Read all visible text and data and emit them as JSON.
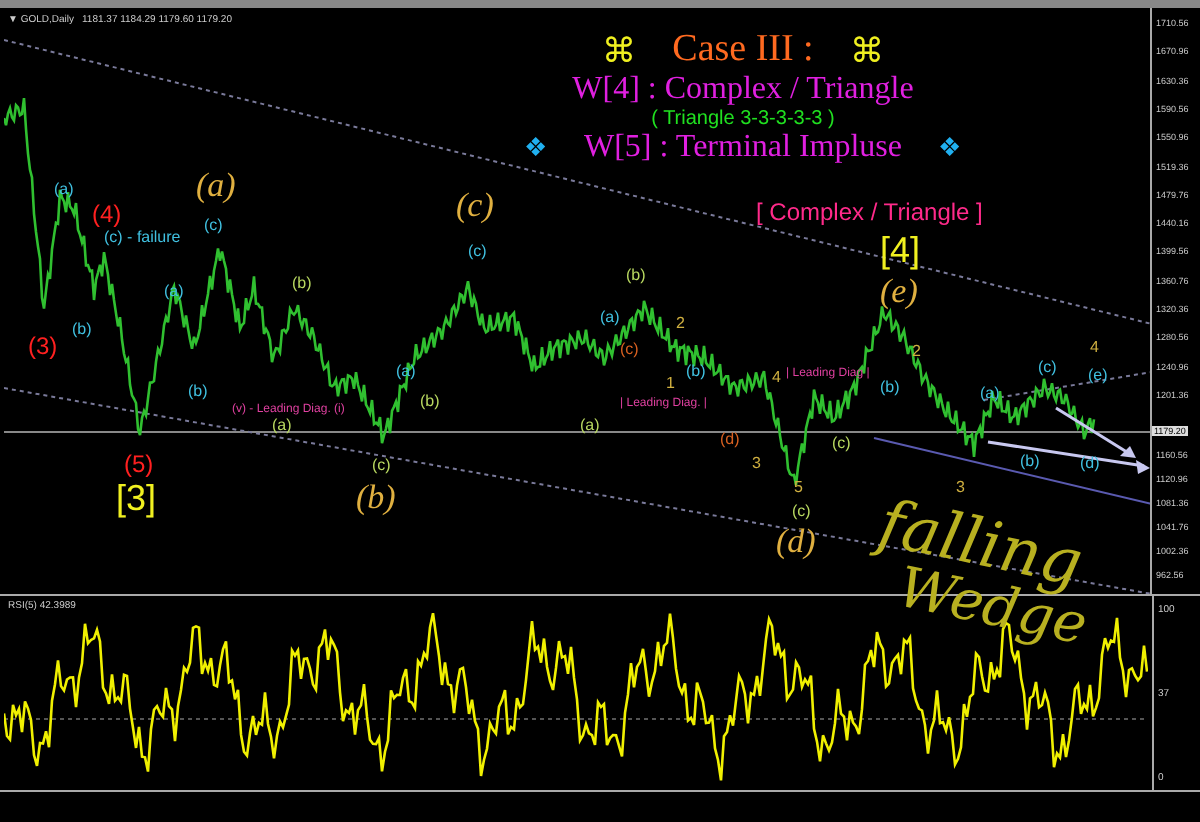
{
  "chart_header": {
    "symbol": "▼ GOLD,Daily",
    "quote": "1181.37 1184.29 1179.60 1179.20"
  },
  "title_block": {
    "mark": "⌘",
    "case_title": "Case III :",
    "line_1": "W[4] : Complex / Triangle",
    "line_2": "( Triangle 3-3-3-3-3 )",
    "bullet": "❖",
    "line_3": "W[5] : Terminal Impluse"
  },
  "wave_labels": [
    {
      "text": "(3)",
      "color": "#ff2020",
      "kind": "mid"
    },
    {
      "text": "(4)",
      "color": "#ff2020",
      "kind": "mid"
    },
    {
      "text": "(5)",
      "color": "#ff2020",
      "kind": "mid"
    },
    {
      "text": "[3]",
      "color": "#f0f020",
      "kind": "big"
    },
    {
      "text": "[ Complex / Triangle ]",
      "color": "#ff2a8a",
      "kind": "mid"
    },
    {
      "text": "[4]",
      "color": "#f0f020",
      "kind": "big"
    },
    {
      "text": "(a)",
      "color": "#e0b040",
      "kind": "italic"
    },
    {
      "text": "(b)",
      "color": "#e0b040",
      "kind": "italic"
    },
    {
      "text": "(c)",
      "color": "#e0b040",
      "kind": "italic"
    },
    {
      "text": "(d)",
      "color": "#e0b040",
      "kind": "italic"
    },
    {
      "text": "(e)",
      "color": "#e0b040",
      "kind": "italic"
    },
    {
      "text": "(a)",
      "color": "#40c0e0",
      "kind": "small"
    },
    {
      "text": "(c) - failure",
      "color": "#40c0e0",
      "kind": "small"
    },
    {
      "text": "(b)",
      "color": "#40c0e0",
      "kind": "small"
    },
    {
      "text": "(c)",
      "color": "#40c0e0",
      "kind": "small"
    },
    {
      "text": "(a)",
      "color": "#40c0e0",
      "kind": "small"
    },
    {
      "text": "(b)",
      "color": "#40c0e0",
      "kind": "small"
    },
    {
      "text": "(c)",
      "color": "#40c0e0",
      "kind": "small"
    },
    {
      "text": "(a)",
      "color": "#40c0e0",
      "kind": "small"
    },
    {
      "text": "(b)",
      "color": "#40c0e0",
      "kind": "small"
    },
    {
      "text": "(a)",
      "color": "#40c0e0",
      "kind": "small"
    },
    {
      "text": "(b)",
      "color": "#40c0e0",
      "kind": "small"
    },
    {
      "text": "(a)",
      "color": "#40c0e0",
      "kind": "small"
    },
    {
      "text": "(c)",
      "color": "#40c0e0",
      "kind": "small"
    },
    {
      "text": "(e)",
      "color": "#40c0e0",
      "kind": "small"
    },
    {
      "text": "(b)",
      "color": "#40c0e0",
      "kind": "small"
    },
    {
      "text": "(d)",
      "color": "#40c0e0",
      "kind": "small"
    },
    {
      "text": "(b)",
      "color": "#b8d860",
      "kind": "small"
    },
    {
      "text": "(a)",
      "color": "#b8d860",
      "kind": "small"
    },
    {
      "text": "(c)",
      "color": "#b8d860",
      "kind": "small"
    },
    {
      "text": "(b)",
      "color": "#b8d860",
      "kind": "small"
    },
    {
      "text": "(a)",
      "color": "#b8d860",
      "kind": "small"
    },
    {
      "text": "(c)",
      "color": "#b8d860",
      "kind": "small"
    },
    {
      "text": "(b)",
      "color": "#b8d860",
      "kind": "small"
    },
    {
      "text": "(c)",
      "color": "#b8d860",
      "kind": "small"
    },
    {
      "text": "(v) - Leading Diag. (i)",
      "color": "#e040a0",
      "kind": "tiny"
    },
    {
      "text": "| Leading Diag. |",
      "color": "#e040a0",
      "kind": "tiny"
    },
    {
      "text": "| Leading Diag |",
      "color": "#e040a0",
      "kind": "tiny"
    },
    {
      "text": "2",
      "color": "#d0b040",
      "kind": "small"
    },
    {
      "text": "1",
      "color": "#d0b040",
      "kind": "small"
    },
    {
      "text": "4",
      "color": "#d0b040",
      "kind": "small"
    },
    {
      "text": "3",
      "color": "#d0b040",
      "kind": "small"
    },
    {
      "text": "5",
      "color": "#d0b040",
      "kind": "small"
    },
    {
      "text": "2",
      "color": "#d0b040",
      "kind": "small"
    },
    {
      "text": "3",
      "color": "#d0b040",
      "kind": "small"
    },
    {
      "text": "4",
      "color": "#d0b040",
      "kind": "small"
    },
    {
      "text": "(d)",
      "color": "#d86020",
      "kind": "small"
    },
    {
      "text": "(c)",
      "color": "#d86020",
      "kind": "small"
    }
  ],
  "handwriting": {
    "line_1": "falling",
    "line_2": "Wedge"
  },
  "price_axis": [
    "1710.56",
    "1670.96",
    "1630.36",
    "1590.56",
    "1550.96",
    "1519.36",
    "1479.76",
    "1440.16",
    "1399.56",
    "1360.76",
    "1320.36",
    "1280.56",
    "1240.96",
    "1201.36",
    "1160.56",
    "1120.96",
    "1081.36",
    "1041.76",
    "1002.36",
    "962.56"
  ],
  "current_price": "1179.20",
  "rsi_panel": {
    "label": "RSI(5) 42.3989",
    "axis": [
      "100",
      "37",
      "0"
    ]
  }
}
